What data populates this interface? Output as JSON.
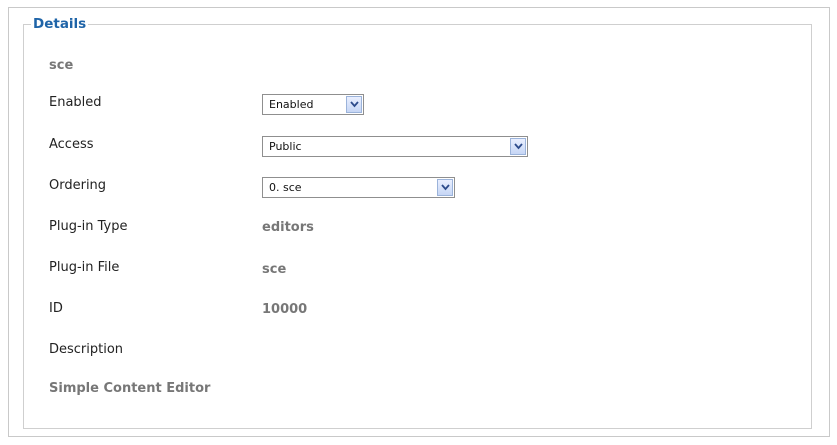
{
  "details": {
    "legend": "Details",
    "name": "sce",
    "fields": {
      "enabled": {
        "label": "Enabled",
        "value": "Enabled"
      },
      "access": {
        "label": "Access",
        "value": "Public"
      },
      "ordering": {
        "label": "Ordering",
        "value": "0. sce"
      },
      "plugin_type": {
        "label": "Plug-in Type",
        "value": "editors"
      },
      "plugin_file": {
        "label": "Plug-in File",
        "value": "sce"
      },
      "id": {
        "label": "ID",
        "value": "10000"
      },
      "description": {
        "label": "Description",
        "value": "Simple Content Editor"
      }
    }
  },
  "icons": {
    "dropdown_arrow": "chevron-down-icon"
  },
  "colors": {
    "legend": "#1f64a8",
    "label": "#222222",
    "readonly_value": "#777777",
    "border": "#cfcfcf"
  }
}
